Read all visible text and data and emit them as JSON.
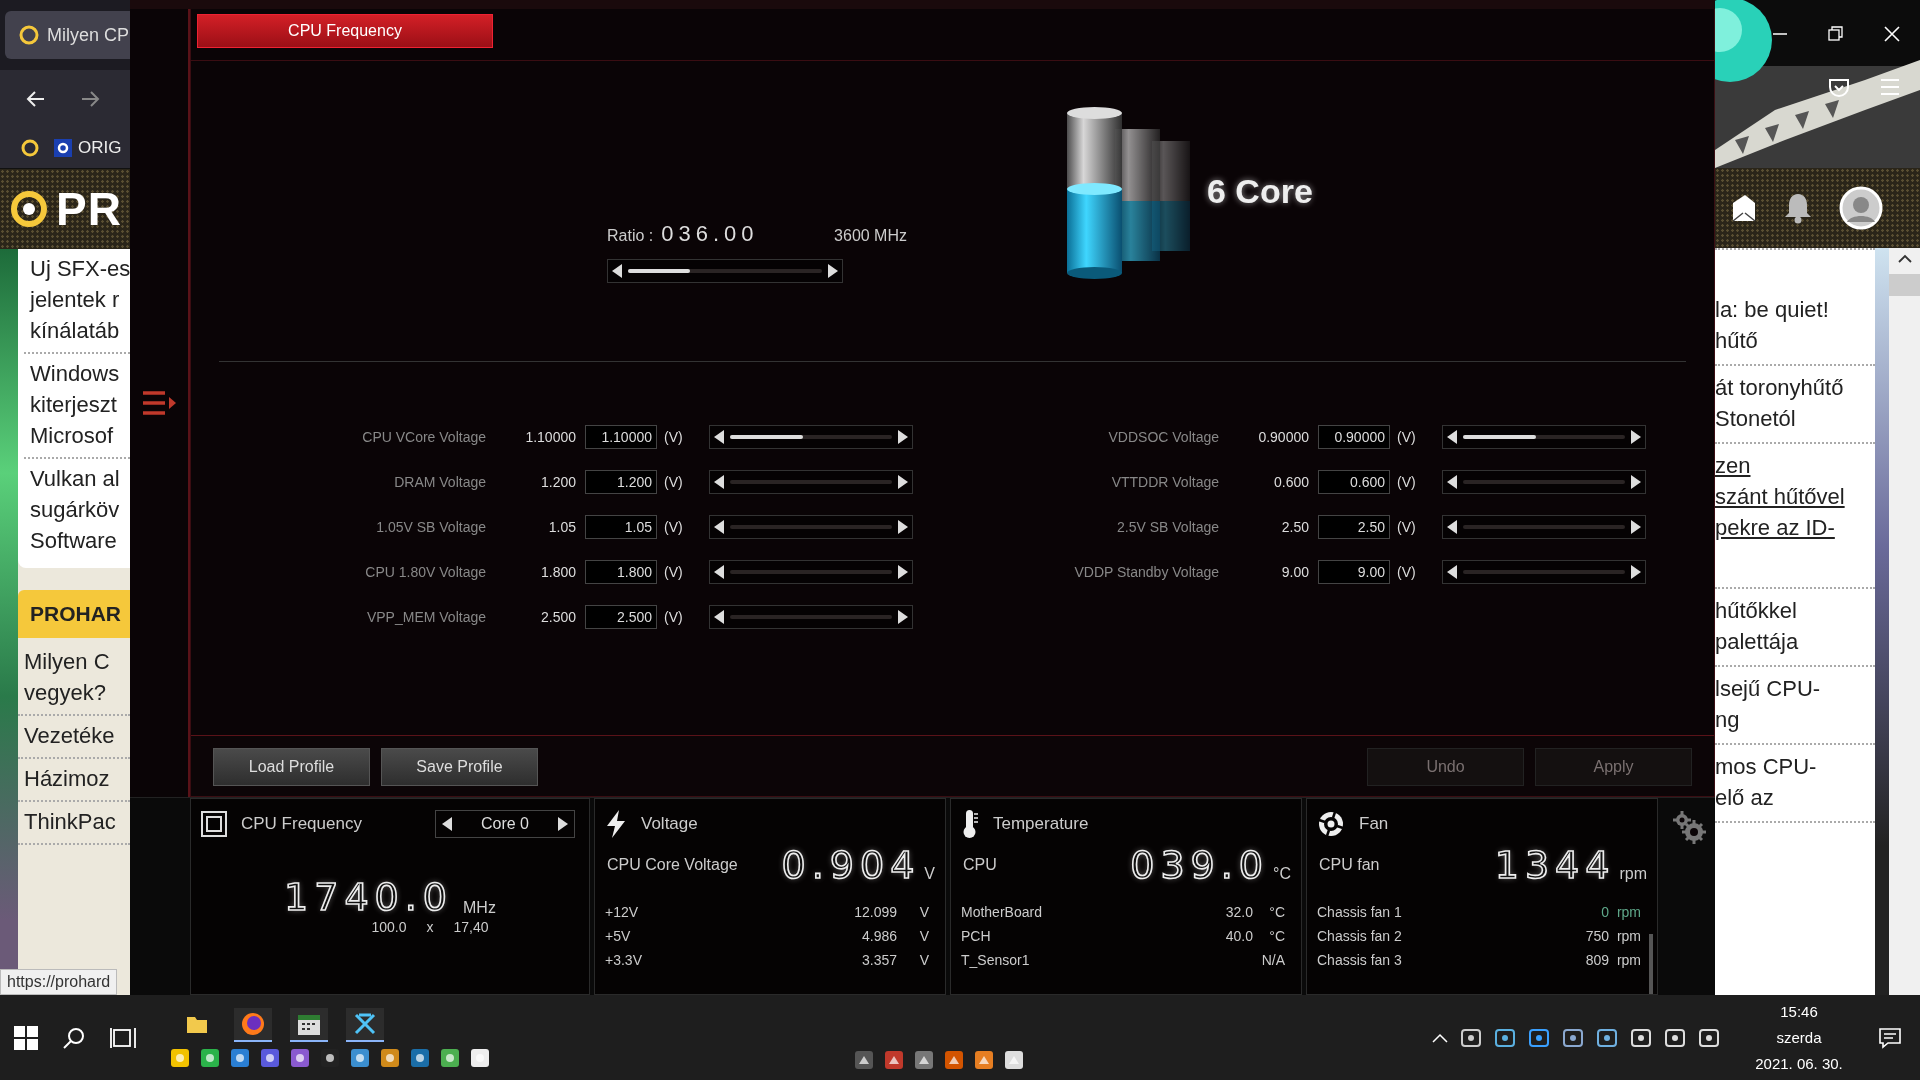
{
  "browser": {
    "tab_title": "Milyen CP",
    "bookmark": "ORIG",
    "site_logo": "PR",
    "left_articles": [
      {
        "lines": [
          "Uj SFX-es",
          "jelentek r",
          "kínálatáb"
        ]
      },
      {
        "lines": [
          "Windows",
          "kiterjeszt",
          "Microsof"
        ]
      },
      {
        "lines": [
          "Vulkan al",
          "sugárköv",
          "Software"
        ]
      }
    ],
    "left_section": "PROHAR",
    "left_section_items": [
      {
        "lines": [
          "Milyen C",
          "vegyek?"
        ]
      },
      {
        "lines": [
          "Vezetéke"
        ]
      },
      {
        "lines": [
          "Házimoz"
        ]
      },
      {
        "lines": [
          "ThinkPac"
        ]
      }
    ],
    "status_url": "https://prohard",
    "right_articles": [
      {
        "lines": [
          "la: be quiet!",
          "hűtő"
        ],
        "link": false
      },
      {
        "lines": [
          "át toronyhűtő",
          "Stonetól"
        ],
        "link": false
      },
      {
        "lines": [
          "zen",
          "szánt hűtővel",
          "pekre az ID-"
        ],
        "link": true
      },
      {
        "lines": [
          "hűtőkkel",
          "palettája"
        ],
        "link": false
      },
      {
        "lines": [
          "lsejű CPU-",
          "ng"
        ],
        "link": false
      },
      {
        "lines": [
          "mos CPU-",
          "elő az"
        ],
        "link": false
      }
    ]
  },
  "app": {
    "tabs": [
      {
        "label": "CPU Frequency",
        "selected": true
      }
    ],
    "ratio_label": "Ratio :",
    "ratio": "036.00",
    "frequency": "3600 MHz",
    "ratio_slider": {
      "level": 0.32
    },
    "cores": "6 Core",
    "voltages_left": [
      {
        "label": "CPU VCore Voltage",
        "value": "1.10000",
        "input": "1.10000",
        "unit": "(V)",
        "level": 0.45
      },
      {
        "label": "DRAM Voltage",
        "value": "1.200",
        "input": "1.200",
        "unit": "(V)",
        "level": 0
      },
      {
        "label": "1.05V SB Voltage",
        "value": "1.05",
        "input": "1.05",
        "unit": "(V)",
        "level": 0
      },
      {
        "label": "CPU 1.80V Voltage",
        "value": "1.800",
        "input": "1.800",
        "unit": "(V)",
        "level": 0
      },
      {
        "label": "VPP_MEM Voltage",
        "value": "2.500",
        "input": "2.500",
        "unit": "(V)",
        "level": 0
      }
    ],
    "voltages_right": [
      {
        "label": "VDDSOC Voltage",
        "value": "0.90000",
        "input": "0.90000",
        "unit": "(V)",
        "level": 0.45
      },
      {
        "label": "VTTDDR Voltage",
        "value": "0.600",
        "input": "0.600",
        "unit": "(V)",
        "level": 0
      },
      {
        "label": "2.5V SB Voltage",
        "value": "2.50",
        "input": "2.50",
        "unit": "(V)",
        "level": 0
      },
      {
        "label": "VDDP Standby Voltage",
        "value": "9.00",
        "input": "9.00",
        "unit": "(V)",
        "level": 0
      }
    ],
    "buttons": [
      {
        "label": "Load Profile",
        "disabled": false
      },
      {
        "label": "Save Profile",
        "disabled": false
      },
      {
        "label": "Undo",
        "disabled": true
      },
      {
        "label": "Apply",
        "disabled": true
      }
    ]
  },
  "monitor": {
    "frequency": {
      "title": "CPU Frequency",
      "core": "Core 0",
      "value": "1740.0",
      "unit": "MHz",
      "base_clock": "100.0",
      "times": "x",
      "multiplier": "17,40"
    },
    "panels": [
      {
        "kind": "voltage",
        "title": "Voltage",
        "main_label": "CPU Core Voltage",
        "main_value": "0.904",
        "main_unit": "V",
        "rows": [
          {
            "label": "+12V",
            "value": "12.099",
            "unit": "V",
            "stopped": false
          },
          {
            "label": "+5V",
            "value": "4.986",
            "unit": "V",
            "stopped": false
          },
          {
            "label": "+3.3V",
            "value": "3.357",
            "unit": "V",
            "stopped": false
          }
        ]
      },
      {
        "kind": "temperature",
        "title": "Temperature",
        "main_label": "CPU",
        "main_value": "039.0",
        "main_unit": "°C",
        "rows": [
          {
            "label": "MotherBoard",
            "value": "32.0",
            "unit": "°C",
            "stopped": false
          },
          {
            "label": "PCH",
            "value": "40.0",
            "unit": "°C",
            "stopped": false
          },
          {
            "label": "T_Sensor1",
            "value": "N/A",
            "stopped": false
          }
        ]
      },
      {
        "kind": "fan",
        "title": "Fan",
        "main_label": "CPU fan",
        "main_value": "1344",
        "main_unit": "rpm",
        "rows": [
          {
            "label": "Chassis fan 1",
            "value": "0",
            "unit": "rpm",
            "stopped": true
          },
          {
            "label": "Chassis fan 2",
            "value": "750",
            "unit": "rpm",
            "stopped": false
          },
          {
            "label": "Chassis fan 3",
            "value": "809",
            "unit": "rpm",
            "stopped": false
          }
        ]
      }
    ]
  },
  "taskbar": {
    "apps": [
      {
        "running": false
      },
      {
        "running": true
      },
      {
        "running": true
      },
      {
        "running": true
      }
    ],
    "time": "15:46",
    "day": "szerda",
    "date": "2021. 06. 30."
  }
}
